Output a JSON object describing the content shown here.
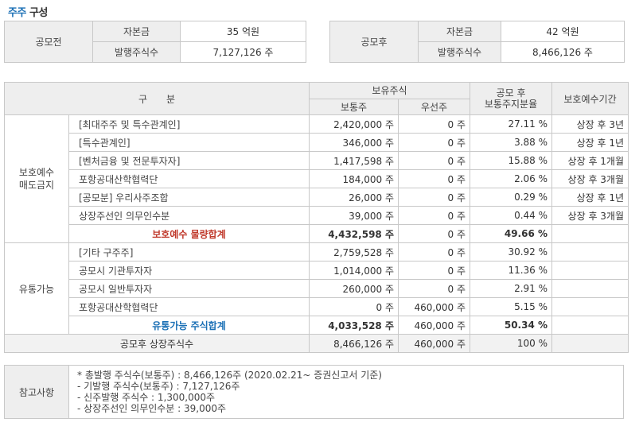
{
  "title": {
    "highlight": "주주",
    "rest": " 구성"
  },
  "before": {
    "label": "공모전",
    "rows": [
      {
        "k": "자본금",
        "v": "35 억원"
      },
      {
        "k": "발행주식수",
        "v": "7,127,126 주"
      }
    ]
  },
  "after": {
    "label": "공모후",
    "rows": [
      {
        "k": "자본금",
        "v": "42 억원"
      },
      {
        "k": "발행주식수",
        "v": "8,466,126 주"
      }
    ]
  },
  "header": {
    "col_group": "구　　분",
    "holdings": "보유주식",
    "common": "보통주",
    "preferred": "우선주",
    "ratio": "공모 후\n보통주지분율",
    "lockup": "보호예수기간"
  },
  "group1": {
    "label": "보호예수\n매도금지",
    "rows": [
      {
        "name": "[최대주주 및 특수관계인]",
        "common": "2,420,000 주",
        "pref": "0 주",
        "ratio": "27.11 %",
        "period": "상장 후 3년"
      },
      {
        "name": "[특수관계인]",
        "common": "346,000 주",
        "pref": "0 주",
        "ratio": "3.88 %",
        "period": "상장 후 1년"
      },
      {
        "name": "[벤처금융 및 전문투자자]",
        "common": "1,417,598 주",
        "pref": "0 주",
        "ratio": "15.88 %",
        "period": "상장 후 1개월"
      },
      {
        "name": "포항공대산학협력단",
        "common": "184,000 주",
        "pref": "0 주",
        "ratio": "2.06 %",
        "period": "상장 후 3개월"
      },
      {
        "name": "[공모분] 우리사주조합",
        "common": "26,000 주",
        "pref": "0 주",
        "ratio": "0.29 %",
        "period": "상장 후 1년"
      },
      {
        "name": "상장주선인 의무인수분",
        "common": "39,000 주",
        "pref": "0 주",
        "ratio": "0.44 %",
        "period": "상장 후 3개월"
      }
    ],
    "sum": {
      "name": "보호예수 물량합계",
      "common": "4,432,598 주",
      "pref": "0 주",
      "ratio": "49.66 %",
      "period": ""
    }
  },
  "group2": {
    "label": "유통가능",
    "rows": [
      {
        "name": "[기타 구주주]",
        "common": "2,759,528 주",
        "pref": "0 주",
        "ratio": "30.92 %",
        "period": ""
      },
      {
        "name": "공모시 기관투자자",
        "common": "1,014,000 주",
        "pref": "0 주",
        "ratio": "11.36 %",
        "period": ""
      },
      {
        "name": "공모시 일반투자자",
        "common": "260,000 주",
        "pref": "0 주",
        "ratio": "2.91 %",
        "period": ""
      },
      {
        "name": "포항공대산학협력단",
        "common": "0 주",
        "pref": "460,000 주",
        "ratio": "5.15 %",
        "period": ""
      }
    ],
    "sum": {
      "name": "유통가능 주식합계",
      "common": "4,033,528 주",
      "pref": "460,000 주",
      "ratio": "50.34 %",
      "period": ""
    }
  },
  "total": {
    "name": "공모후 상장주식수",
    "common": "8,466,126 주",
    "pref": "460,000 주",
    "ratio": "100 %",
    "period": ""
  },
  "notes": {
    "label": "참고사항",
    "lines": [
      "* 총발행 주식수(보통주) : 8,466,126주 (2020.02.21~ 증권신고서 기준)",
      "- 기발행 주식수(보통주) : 7,127,126주",
      "- 신주발행 주식수 : 1,300,000주",
      "- 상장주선인 의무인수분 : 39,000주"
    ]
  }
}
